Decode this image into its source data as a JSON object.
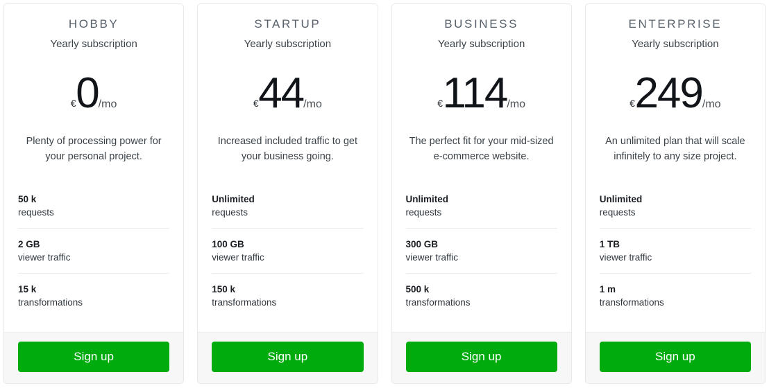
{
  "accent_color": "#00ab0d",
  "card_border_color": "#e8e8e8",
  "footer_bg_color": "#f7f7f7",
  "plans": [
    {
      "name": "HOBBY",
      "subtitle": "Yearly subscription",
      "currency": "€",
      "amount": "0",
      "period": "/mo",
      "description": "Plenty of processing power for your personal project.",
      "features": [
        {
          "value": "50 k",
          "label": "requests"
        },
        {
          "value": "2 GB",
          "label": "viewer traffic"
        },
        {
          "value": "15 k",
          "label": "transformations"
        }
      ],
      "cta": "Sign up"
    },
    {
      "name": "STARTUP",
      "subtitle": "Yearly subscription",
      "currency": "€",
      "amount": "44",
      "period": "/mo",
      "description": "Increased included traffic to get your business going.",
      "features": [
        {
          "value": "Unlimited",
          "label": "requests"
        },
        {
          "value": "100 GB",
          "label": "viewer traffic"
        },
        {
          "value": "150 k",
          "label": "transformations"
        }
      ],
      "cta": "Sign up"
    },
    {
      "name": "BUSINESS",
      "subtitle": "Yearly subscription",
      "currency": "€",
      "amount": "114",
      "period": "/mo",
      "description": "The perfect fit for your mid-sized e-commerce website.",
      "features": [
        {
          "value": "Unlimited",
          "label": "requests"
        },
        {
          "value": "300 GB",
          "label": "viewer traffic"
        },
        {
          "value": "500 k",
          "label": "transformations"
        }
      ],
      "cta": "Sign up"
    },
    {
      "name": "ENTERPRISE",
      "subtitle": "Yearly subscription",
      "currency": "€",
      "amount": "249",
      "period": "/mo",
      "description": "An unlimited plan that will scale infinitely to any size project.",
      "features": [
        {
          "value": "Unlimited",
          "label": "requests"
        },
        {
          "value": "1 TB",
          "label": "viewer traffic"
        },
        {
          "value": "1 m",
          "label": "transformations"
        }
      ],
      "cta": "Sign up"
    }
  ]
}
